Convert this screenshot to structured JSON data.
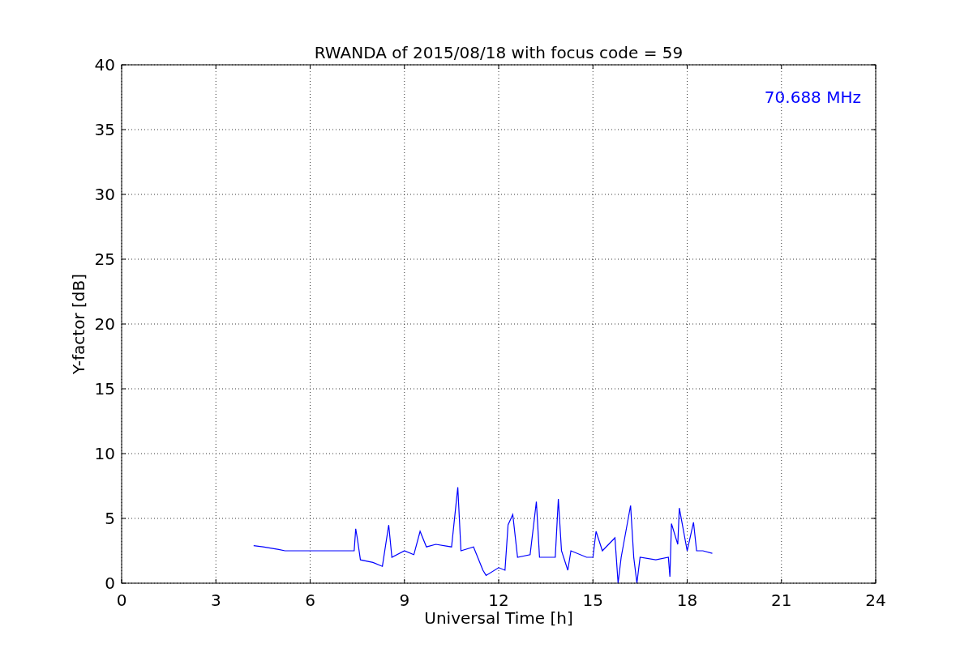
{
  "chart_data": {
    "type": "line",
    "title": "RWANDA of 2015/08/18 with focus code = 59",
    "xlabel": "Universal Time [h]",
    "ylabel": "Y-factor [dB]",
    "xlim": [
      0,
      24
    ],
    "ylim": [
      0,
      40
    ],
    "xticks": [
      0,
      3,
      6,
      9,
      12,
      15,
      18,
      21,
      24
    ],
    "yticks": [
      0,
      5,
      10,
      15,
      20,
      25,
      30,
      35,
      40
    ],
    "x": [
      4.2,
      4.5,
      5.0,
      5.2,
      7.4,
      7.45,
      7.5,
      7.6,
      8.0,
      8.3,
      8.5,
      8.6,
      9.0,
      9.3,
      9.5,
      9.7,
      10.0,
      10.5,
      10.7,
      10.8,
      11.2,
      11.5,
      11.6,
      12.0,
      12.2,
      12.3,
      12.45,
      12.6,
      13.0,
      13.2,
      13.3,
      13.8,
      13.9,
      14.0,
      14.2,
      14.3,
      14.8,
      15.0,
      15.1,
      15.3,
      15.7,
      15.8,
      15.9,
      16.2,
      16.3,
      16.4,
      16.5,
      17.0,
      17.4,
      17.45,
      17.5,
      17.7,
      17.75,
      18.0,
      18.2,
      18.3,
      18.5,
      18.8
    ],
    "series": [
      {
        "color": "#0000ff",
        "values": [
          2.9,
          2.8,
          2.6,
          2.5,
          2.5,
          4.2,
          3.5,
          1.8,
          1.6,
          1.3,
          4.5,
          2.0,
          2.5,
          2.2,
          4.0,
          2.8,
          3.0,
          2.8,
          7.4,
          2.5,
          2.8,
          1.0,
          0.6,
          1.2,
          1.0,
          4.5,
          5.3,
          2.0,
          2.2,
          6.3,
          2.0,
          2.0,
          6.5,
          2.5,
          1.0,
          2.5,
          2.0,
          2.0,
          4.0,
          2.5,
          3.5,
          0.0,
          2.0,
          6.0,
          2.0,
          0.0,
          2.0,
          1.8,
          2.0,
          0.5,
          4.6,
          3.0,
          5.8,
          2.5,
          4.7,
          2.5,
          2.5,
          2.3
        ]
      }
    ],
    "grid": true,
    "annotations": [
      "70.688 MHz"
    ]
  }
}
